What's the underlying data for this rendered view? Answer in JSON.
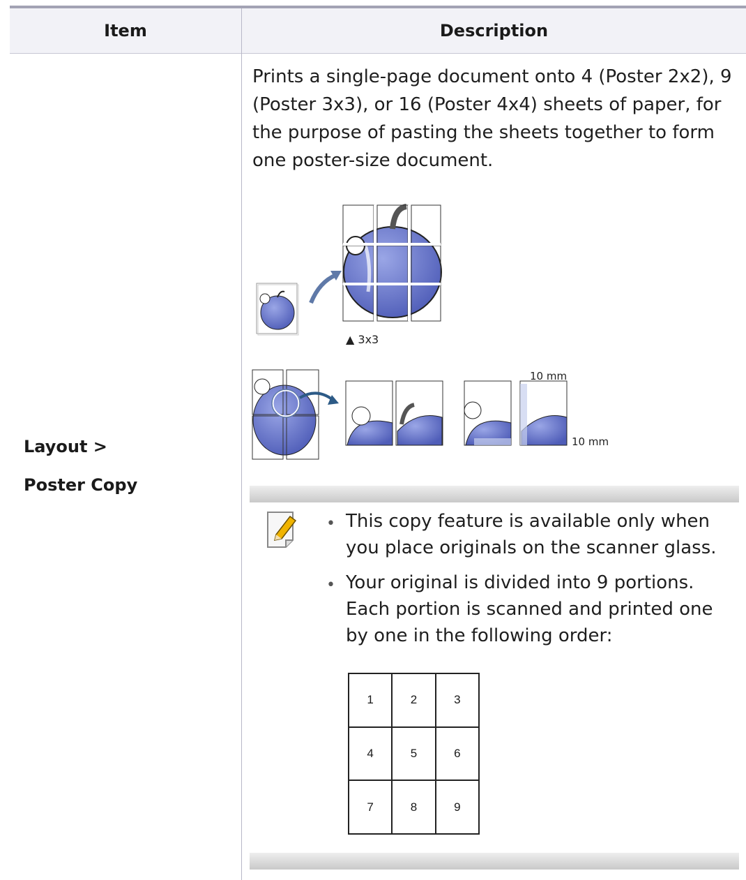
{
  "table": {
    "headers": {
      "item": "Item",
      "description": "Description"
    },
    "row": {
      "item_line1": "Layout >",
      "item_line2": "Poster Copy",
      "description": "Prints a single-page document onto 4 (Poster 2x2), 9 (Poster 3x3), or 16 (Poster 4x4) sheets of paper, for the purpose of pasting the sheets together to form one poster-size document."
    }
  },
  "illustration": {
    "grid_caption": "▲ 3x3",
    "margin_label_top": "10 mm",
    "margin_label_side": "10 mm"
  },
  "note": {
    "icon": "note-pencil-icon",
    "bullets": [
      "This copy feature is available only when you place originals on the scanner glass.",
      "Your original is divided into 9 portions. Each portion is scanned and printed one by one in the following order:"
    ],
    "order_grid": [
      "1",
      "2",
      "3",
      "4",
      "5",
      "6",
      "7",
      "8",
      "9"
    ]
  },
  "colors": {
    "apple": "#6a78c8",
    "header_bg": "#f2f2f7",
    "rule": "#a3a3b4"
  }
}
